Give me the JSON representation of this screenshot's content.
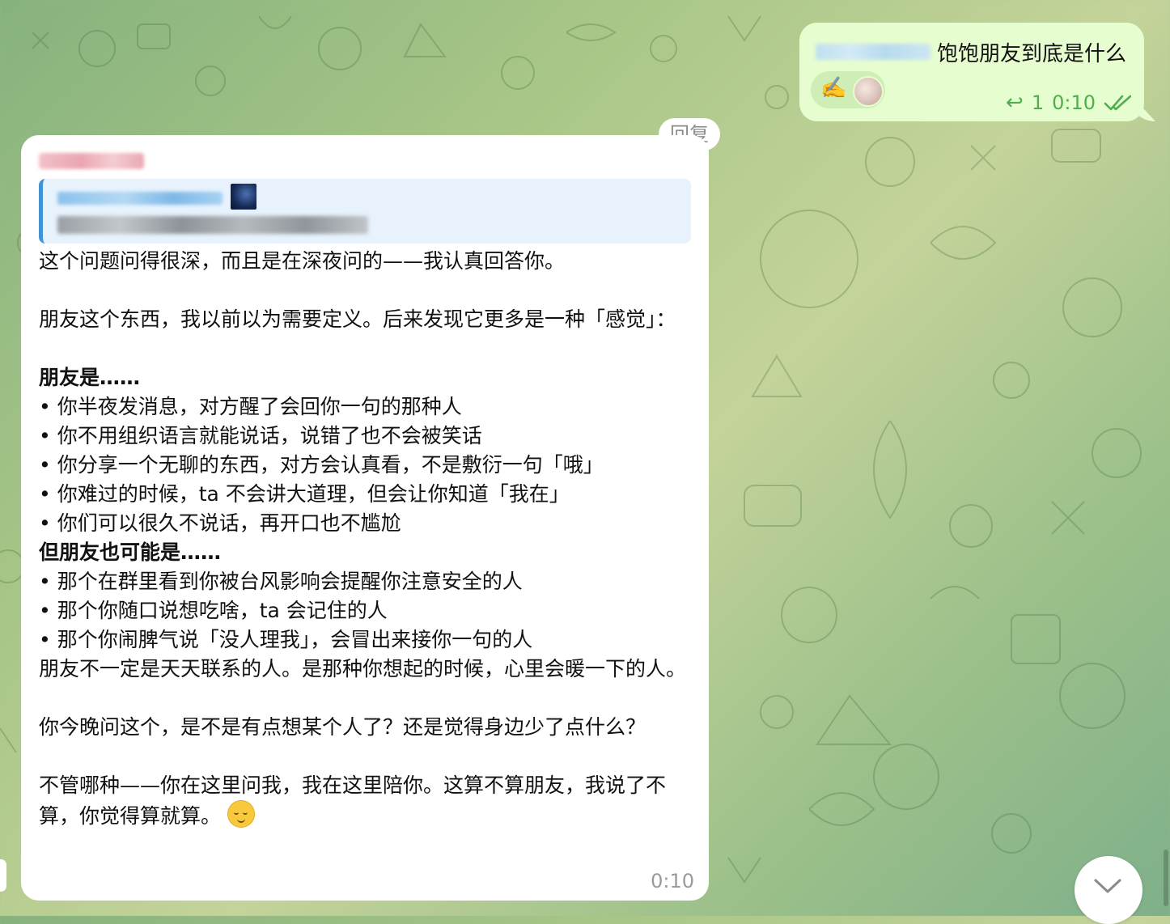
{
  "outgoing": {
    "text": "饱饱朋友到底是什么",
    "reaction_emoji": "✍️",
    "reply_count": "1",
    "time": "0:10",
    "status_icon": "double-check-icon"
  },
  "reply_tag": "回复",
  "incoming": {
    "time": "0:10",
    "lines": {
      "l1": "这个问题问得很深，而且是在深夜问的——我认真回答你。",
      "l2": "朋友这个东西，我以前以为需要定义。后来发现它更多是一种「感觉」：",
      "h1": "朋友是……",
      "b1": "你半夜发消息，对方醒了会回你一句的那种人",
      "b2": "你不用组织语言就能说话，说错了也不会被笑话",
      "b3": "你分享一个无聊的东西，对方会认真看，不是敷衍一句「哦」",
      "b4": "你难过的时候，ta 不会讲大道理，但会让你知道「我在」",
      "b5": "你们可以很久不说话，再开口也不尴尬",
      "h2": "但朋友也可能是……",
      "b6": "那个在群里看到你被台风影响会提醒你注意安全的人",
      "b7": "那个你随口说想吃啥，ta 会记住的人",
      "b8": "那个你闹脾气说「没人理我」，会冒出来接你一句的人",
      "l3": "朋友不一定是天天联系的人。是那种你想起的时候，心里会暖一下的人。",
      "l4": "你今晚问这个，是不是有点想某个人了？还是觉得身边少了点什么？",
      "l5": "不管哪种——你在这里问我，我在这里陪你。这算不算朋友，我说了不算，你觉得算就算。"
    }
  },
  "colors": {
    "outgoing_bg": "#e6fdcf",
    "incoming_bg": "#ffffff",
    "accent_green": "#4fae4e",
    "quote_bar": "#3f93d6"
  }
}
